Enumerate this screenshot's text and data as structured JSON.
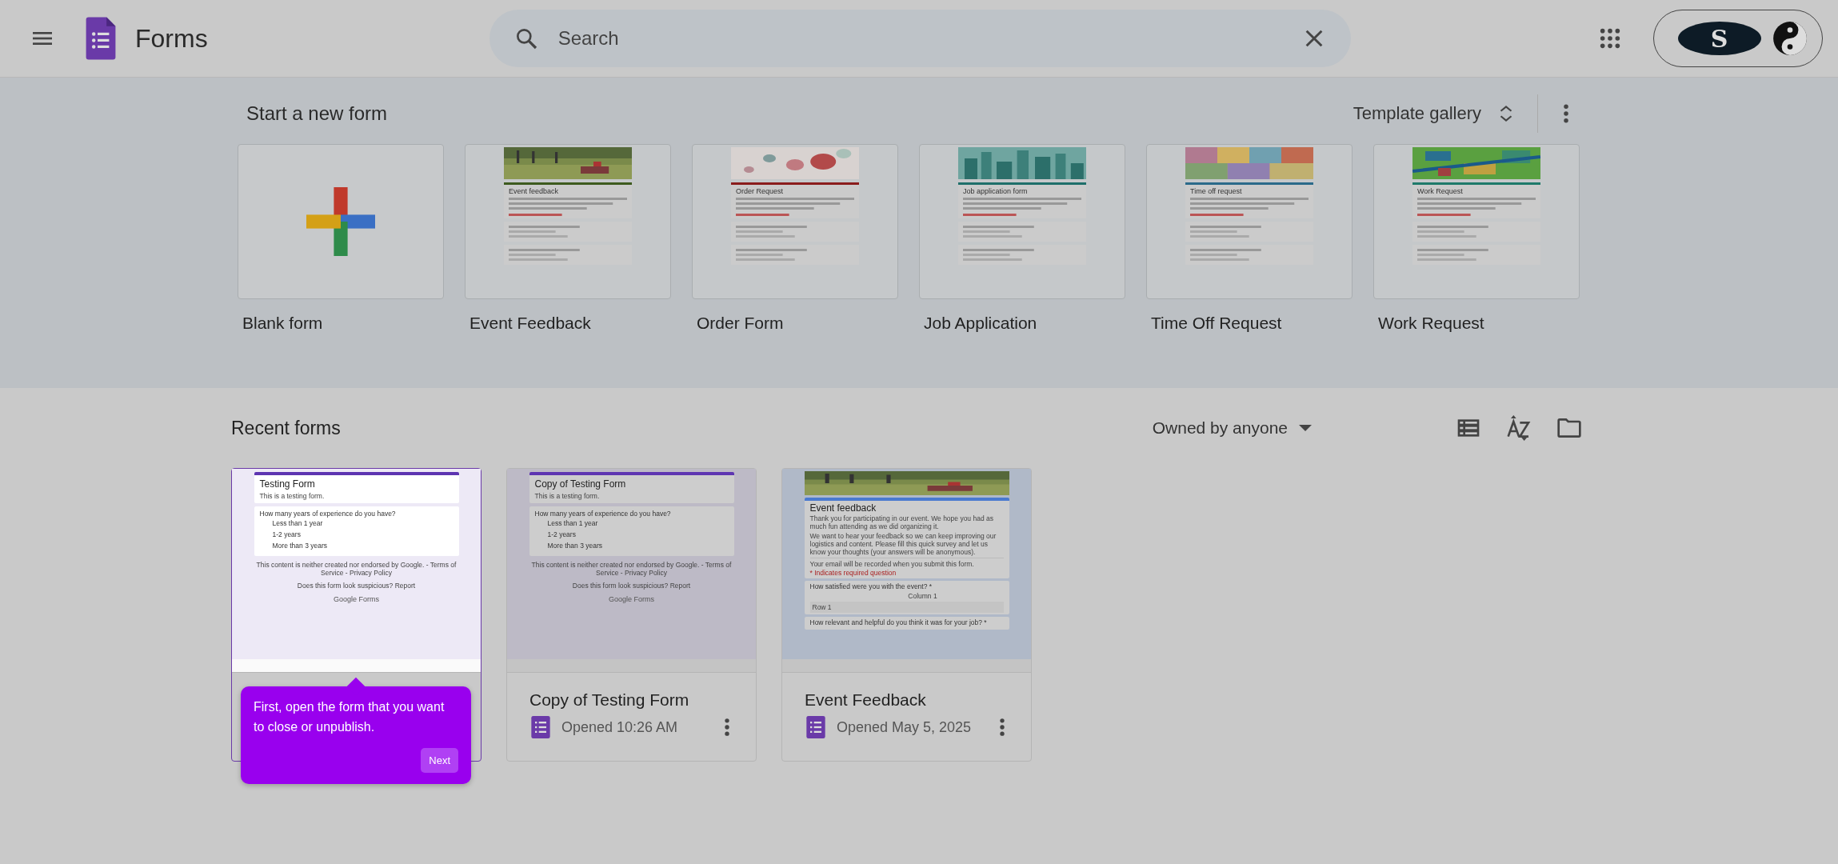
{
  "header": {
    "app_title": "Forms",
    "search": {
      "placeholder": "Search"
    },
    "account_logo_letter": "S"
  },
  "templates": {
    "heading": "Start a new form",
    "gallery_button": "Template gallery",
    "items": [
      {
        "kind": "blank",
        "label": "Blank form"
      },
      {
        "kind": "template",
        "label": "Event Feedback",
        "preview_title": "Event feedback",
        "color": "#3d5a1e"
      },
      {
        "kind": "template",
        "label": "Order Form",
        "preview_title": "Order Request",
        "color": "#8a1c1c"
      },
      {
        "kind": "template",
        "label": "Job Application",
        "preview_title": "Job application form",
        "color": "#1f6f6a"
      },
      {
        "kind": "template",
        "label": "Time Off Request",
        "preview_title": "Time off request",
        "color": "#2b6a8a"
      },
      {
        "kind": "template",
        "label": "Work Request",
        "preview_title": "Work Request",
        "color": "#1f7a6a"
      }
    ]
  },
  "recent": {
    "heading": "Recent forms",
    "owner_filter": "Owned by anyone",
    "forms": [
      {
        "kind": "plain",
        "selected": true,
        "preview": {
          "title": "Testing Form",
          "description": "This is a testing form.",
          "question": "How many years of experience do you have?",
          "options": [
            "Less than 1 year",
            "1-2 years",
            "More than 3 years"
          ],
          "disclaimer": "This content is neither created nor endorsed by Google. - Terms of Service - Privacy Policy",
          "report": "Does this form look suspicious? Report",
          "brand": "Google Forms"
        }
      },
      {
        "kind": "plain",
        "selected": false,
        "title": "Copy of Testing Form",
        "opened": "Opened 10:26 AM",
        "preview": {
          "title": "Copy of Testing Form",
          "description": "This is a testing form.",
          "question": "How many years of experience do you have?",
          "options": [
            "Less than 1 year",
            "1-2 years",
            "More than 3 years"
          ],
          "disclaimer": "This content is neither created nor endorsed by Google. - Terms of Service - Privacy Policy",
          "report": "Does this form look suspicious? Report",
          "brand": "Google Forms"
        }
      },
      {
        "selected": false,
        "title": "Event Feedback",
        "opened": "Opened May 5, 2025",
        "preview": {
          "title": "Event feedback",
          "description": "Thank you for participating in our event. We hope you had as much fun attending as we did organizing it.",
          "description_2": "We want to hear your feedback so we can keep improving our logistics and content. Please fill this quick survey and let us know your thoughts (your answers will be anonymous).",
          "email_note": "Your email will be recorded when you submit this form.",
          "required_note": "* Indicates required question",
          "question": "How satisfied were you with the event? *",
          "column": "Column 1",
          "row": "Row 1",
          "question_2": "How relevant and helpful do you think it was for your job? *"
        }
      }
    ]
  },
  "tooltip": {
    "text": "First, open the form that you want to close or unpublish.",
    "button": "Next"
  }
}
